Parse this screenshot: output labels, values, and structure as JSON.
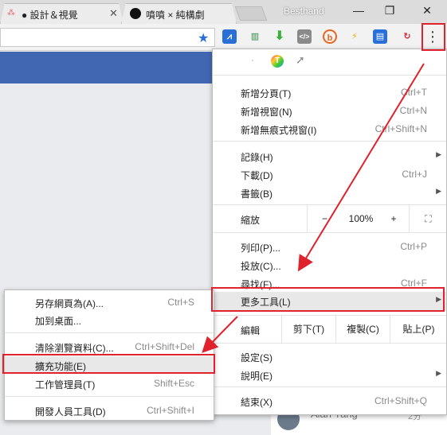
{
  "tabs": [
    {
      "label": "設計＆視覺",
      "dot": "●"
    },
    {
      "label": "噴噴 × 純構劇",
      "dot": ""
    }
  ],
  "window": {
    "title": "Besthand",
    "min": "—",
    "max": "❐",
    "close": "✕"
  },
  "toolbar": {
    "star": "★",
    "menu": "⋮"
  },
  "icon_row": {
    "dot": "·",
    "t_icon": "T"
  },
  "menu": {
    "new_tab": {
      "label": "新增分頁(T)",
      "shortcut": "Ctrl+T"
    },
    "new_window": {
      "label": "新增視窗(N)",
      "shortcut": "Ctrl+N"
    },
    "new_incognito": {
      "label": "新增無痕式視窗(I)",
      "shortcut": "Ctrl+Shift+N"
    },
    "history": {
      "label": "記錄(H)"
    },
    "downloads": {
      "label": "下載(D)",
      "shortcut": "Ctrl+J"
    },
    "bookmarks": {
      "label": "書籤(B)"
    },
    "zoom": {
      "label": "縮放",
      "minus": "−",
      "value": "100%",
      "plus": "+",
      "fullscreen": "⛶"
    },
    "print": {
      "label": "列印(P)...",
      "shortcut": "Ctrl+P"
    },
    "cast": {
      "label": "投放(C)..."
    },
    "find": {
      "label": "尋找(F)...",
      "shortcut": "Ctrl+F"
    },
    "more_tools": {
      "label": "更多工具(L)"
    },
    "edit": {
      "label": "編輯",
      "cut": "剪下(T)",
      "copy": "複製(C)",
      "paste": "貼上(P)"
    },
    "settings": {
      "label": "設定(S)"
    },
    "help": {
      "label": "說明(E)"
    },
    "exit": {
      "label": "結束(X)",
      "shortcut": "Ctrl+Shift+Q"
    },
    "arrow": "▶"
  },
  "submenu": {
    "save_as": {
      "label": "另存網頁為(A)...",
      "shortcut": "Ctrl+S"
    },
    "add_desktop": {
      "label": "加到桌面..."
    },
    "clear_data": {
      "label": "清除瀏覽資料(C)...",
      "shortcut": "Ctrl+Shift+Del"
    },
    "extensions": {
      "label": "擴充功能(E)"
    },
    "task_manager": {
      "label": "工作管理員(T)",
      "shortcut": "Shift+Esc"
    },
    "dev_tools": {
      "label": "開發人員工具(D)",
      "shortcut": "Ctrl+Shift+I"
    }
  },
  "chat": {
    "name": "Alan Yang",
    "time": "2分"
  },
  "colors": {
    "highlight": "#e0222c",
    "facebook": "#4267b2",
    "star": "#2a6fd8"
  }
}
